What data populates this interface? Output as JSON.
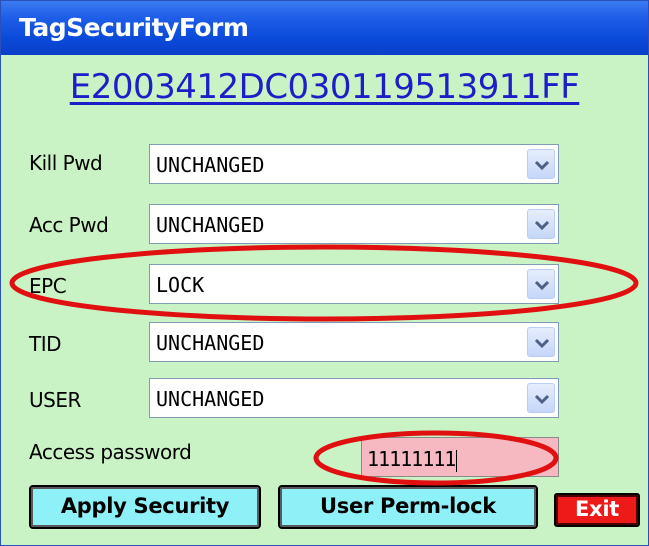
{
  "window": {
    "title": "TagSecurityForm"
  },
  "tag": {
    "epc_id": "E2003412DC030119513911FF"
  },
  "rows": [
    {
      "label": "Kill Pwd",
      "value": "UNCHANGED"
    },
    {
      "label": "Acc Pwd",
      "value": "UNCHANGED"
    },
    {
      "label": "EPC",
      "value": "LOCK"
    },
    {
      "label": "TID",
      "value": "UNCHANGED"
    },
    {
      "label": "USER",
      "value": "UNCHANGED"
    }
  ],
  "access_password": {
    "label": "Access password",
    "value": "11111111"
  },
  "buttons": {
    "apply": "Apply Security",
    "perm_lock": "User Perm-lock",
    "exit": "Exit"
  },
  "colors": {
    "background": "#c9f3c4",
    "titlebar": "#0a4ad9",
    "button": "#8ff1f8",
    "exit": "#ee1a1a",
    "password_field": "#f6b9c2",
    "highlight": "#e01010"
  },
  "icons": {
    "dropdown": "chevron-down-icon"
  }
}
